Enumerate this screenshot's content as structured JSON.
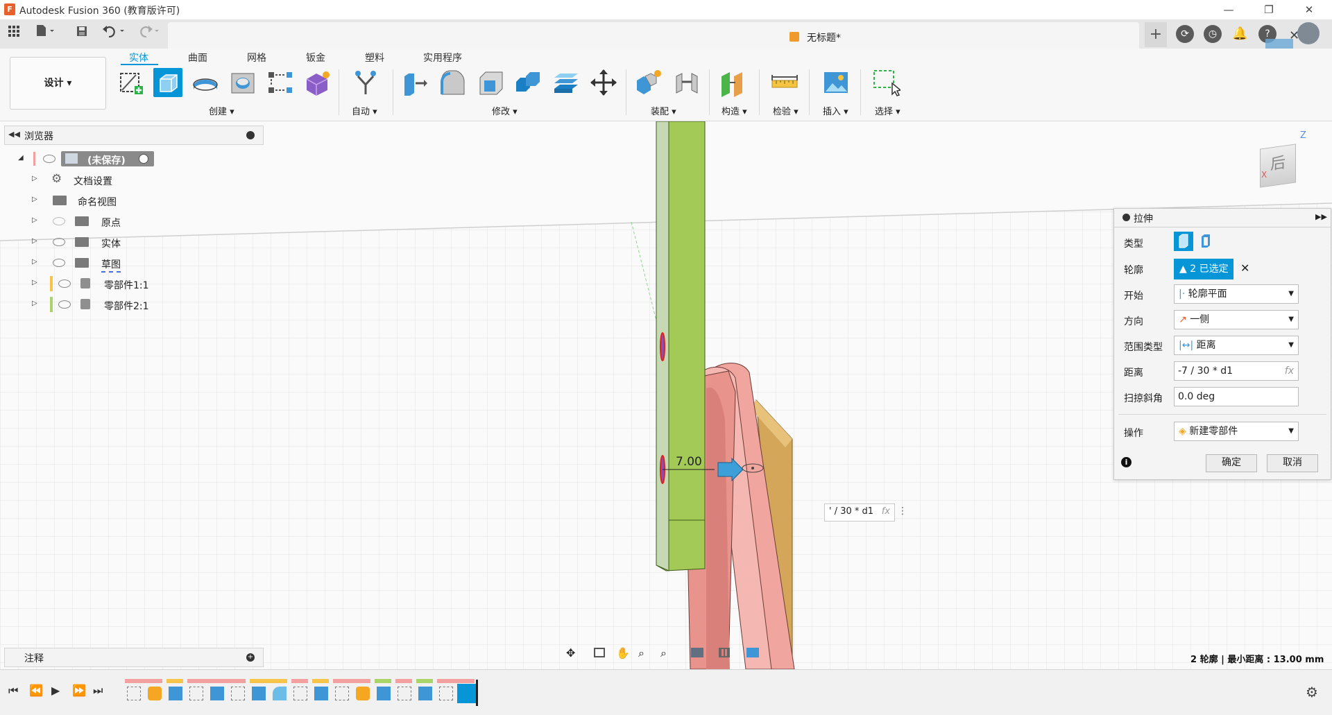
{
  "app": {
    "title": "Autodesk Fusion 360 (教育版许可)",
    "logo": "F"
  },
  "window_controls": {
    "minimize": "—",
    "restore": "❐",
    "close": "✕"
  },
  "document": {
    "title": "无标题*",
    "close": "✕"
  },
  "workspace": {
    "label": "设计 ▾"
  },
  "ribbon_tabs": [
    "实体",
    "曲面",
    "网格",
    "钣金",
    "塑料",
    "实用程序"
  ],
  "ribbon_groups": {
    "create": "创建 ▾",
    "automate": "自动 ▾",
    "modify": "修改 ▾",
    "assemble": "装配 ▾",
    "construct": "构造 ▾",
    "inspect": "检验 ▾",
    "insert": "插入 ▾",
    "select": "选择 ▾"
  },
  "browser": {
    "title": "浏览器",
    "root_label": "(未保存)",
    "items": [
      {
        "label": "文档设置",
        "icon": "gear-icon"
      },
      {
        "label": "命名视图",
        "icon": "folder-icon"
      },
      {
        "label": "原点",
        "icon": "folder-icon"
      },
      {
        "label": "实体",
        "icon": "folder-icon"
      },
      {
        "label": "草图",
        "icon": "folder-icon"
      },
      {
        "label": "零部件1:1",
        "icon": "component-icon",
        "color": "#f7c44a"
      },
      {
        "label": "零部件2:1",
        "icon": "component-icon",
        "color": "#a8d46a"
      }
    ]
  },
  "viewcube": {
    "face": "后",
    "z_axis": "Z",
    "x_axis": "X"
  },
  "dimension": {
    "value": "7.00"
  },
  "floating_input": {
    "value": "' / 30 * d1",
    "fx": "fx"
  },
  "extrude_panel": {
    "title": "拉伸",
    "rows": [
      {
        "label": "类型"
      },
      {
        "label": "轮廓",
        "value": "2 已选定"
      },
      {
        "label": "开始",
        "value": "轮廓平面"
      },
      {
        "label": "方向",
        "value": "一侧"
      },
      {
        "label": "范围类型",
        "value": "距离"
      },
      {
        "label": "距离",
        "value": "-7 / 30 * d1",
        "fx": "fx"
      },
      {
        "label": "扫掠斜角",
        "value": "0.0 deg"
      },
      {
        "label": "操作",
        "value": "新建零部件"
      }
    ],
    "ok": "确定",
    "cancel": "取消"
  },
  "notes": {
    "title": "注释"
  },
  "status": {
    "text": "2 轮廓 | 最小距离 : 13.00 mm"
  },
  "colors": {
    "accent": "#0696d7",
    "green_part": "#a3c957",
    "pink_part": "#f0a59f",
    "tan_part": "#d3a65a"
  }
}
